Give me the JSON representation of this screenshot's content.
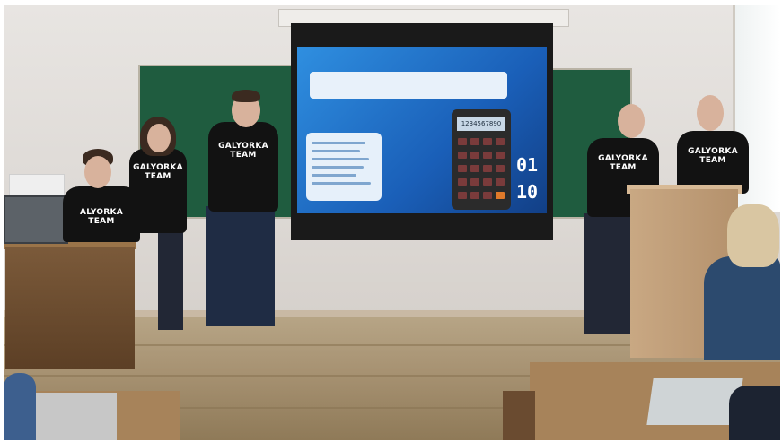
{
  "photo": {
    "slide": {
      "header_text": "",
      "phone_display": "1234567890",
      "digits_top": "01",
      "digits_bottom": "10"
    },
    "shirts": {
      "seated": "ALYORKA\nTEAM",
      "standing_left": "GALYORKA\nTEAM",
      "standing_center": "GALYORKA\nTEAM",
      "standing_right_1": "GALYORKA\nTEAM",
      "standing_right_2": "GALYORKA\nTEAM"
    }
  }
}
